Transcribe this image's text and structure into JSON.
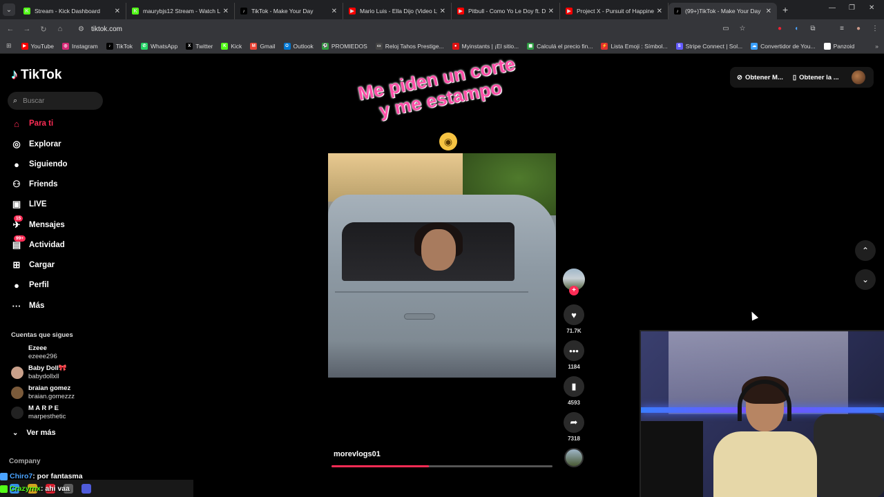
{
  "browser": {
    "tabs": [
      {
        "label": "Stream - Kick Dashboard",
        "fav_color": "#53fc18",
        "fav_text": "K",
        "active": false
      },
      {
        "label": "maurybjs12 Stream - Watch Live",
        "fav_color": "#53fc18",
        "fav_text": "K",
        "active": false
      },
      {
        "label": "TikTok - Make Your Day",
        "fav_color": "#000000",
        "fav_text": "♪",
        "active": false
      },
      {
        "label": "Mario Luis - Ella Dijo (Video Lyric)",
        "fav_color": "#ff0000",
        "fav_text": "▶",
        "active": false
      },
      {
        "label": "Pitbull - Como Yo Le Doy ft. Don",
        "fav_color": "#ff0000",
        "fav_text": "▶",
        "active": false
      },
      {
        "label": "Project X - Pursuit of Happiness",
        "fav_color": "#ff0000",
        "fav_text": "▶",
        "active": false
      },
      {
        "label": "(99+)TikTok - Make Your Day",
        "fav_color": "#000000",
        "fav_text": "♪",
        "active": true
      }
    ],
    "url": "tiktok.com",
    "bookmarks": [
      {
        "label": "YouTube",
        "color": "#ff0000",
        "glyph": "▶"
      },
      {
        "label": "Instagram",
        "color": "#d62976",
        "glyph": "◎"
      },
      {
        "label": "TikTok",
        "color": "#000000",
        "glyph": "♪"
      },
      {
        "label": "WhatsApp",
        "color": "#25d366",
        "glyph": "✆"
      },
      {
        "label": "Twitter",
        "color": "#000000",
        "glyph": "X"
      },
      {
        "label": "Kick",
        "color": "#53fc18",
        "glyph": "K"
      },
      {
        "label": "Gmail",
        "color": "#ea4335",
        "glyph": "M"
      },
      {
        "label": "Outlook",
        "color": "#0078d4",
        "glyph": "O"
      },
      {
        "label": "PROMIEDOS",
        "color": "#2e9e3e",
        "glyph": "⚽"
      },
      {
        "label": "Reloj Tahos Prestige...",
        "color": "#444444",
        "glyph": "▭"
      },
      {
        "label": "Myinstants | ¡El sitio...",
        "color": "#d11",
        "glyph": "●"
      },
      {
        "label": "Calculá el precio fin...",
        "color": "#2f9e44",
        "glyph": "▦"
      },
      {
        "label": "Lista Emoji : Símbol...",
        "color": "#e0302e",
        "glyph": "⚡"
      },
      {
        "label": "Stripe Connect | Sol...",
        "color": "#635bff",
        "glyph": "S"
      },
      {
        "label": "Convertidor de You...",
        "color": "#3aa0ff",
        "glyph": "☁"
      },
      {
        "label": "Panzoid",
        "color": "#ffffff",
        "glyph": "P"
      }
    ]
  },
  "tiktok": {
    "brand": "TikTok",
    "search_placeholder": "Buscar",
    "nav": [
      {
        "label": "Para ti",
        "icon": "home-icon",
        "glyph": "⌂",
        "active": true,
        "badge": ""
      },
      {
        "label": "Explorar",
        "icon": "compass-icon",
        "glyph": "◎",
        "active": false,
        "badge": ""
      },
      {
        "label": "Siguiendo",
        "icon": "following-avatar-icon",
        "glyph": "●",
        "active": false,
        "badge": ""
      },
      {
        "label": "Friends",
        "icon": "friends-icon",
        "glyph": "⚇",
        "active": false,
        "badge": ""
      },
      {
        "label": "LIVE",
        "icon": "live-icon",
        "glyph": "▣",
        "active": false,
        "badge": ""
      },
      {
        "label": "Mensajes",
        "icon": "messages-icon",
        "glyph": "✈",
        "active": false,
        "badge": "15"
      },
      {
        "label": "Actividad",
        "icon": "activity-icon",
        "glyph": "▤",
        "active": false,
        "badge": "99+"
      },
      {
        "label": "Cargar",
        "icon": "upload-icon",
        "glyph": "⊞",
        "active": false,
        "badge": ""
      },
      {
        "label": "Perfil",
        "icon": "profile-avatar-icon",
        "glyph": "●",
        "active": false,
        "badge": ""
      },
      {
        "label": "Más",
        "icon": "more-icon",
        "glyph": "···",
        "active": false,
        "badge": ""
      }
    ],
    "following_header": "Cuentas que sigues",
    "following": [
      {
        "name": "Ezeee",
        "handle": "ezeee296",
        "color": "#000000"
      },
      {
        "name": "Baby Doll🎀",
        "handle": "babydollxll",
        "color": "#c9a08a"
      },
      {
        "name": "braian gomez",
        "handle": "braian.gomezzz",
        "color": "#7a5a3a"
      },
      {
        "name": "M A R P E",
        "handle": "marpesthetic",
        "color": "#222222"
      }
    ],
    "see_more": "Ver más",
    "company": "Company",
    "top_buttons": [
      "Obtener M...",
      "Obtener la ..."
    ],
    "caption_line1": "Me piden un corte",
    "caption_line2": "y me estampo",
    "video_author": "morevlogs01",
    "progress": 0.44,
    "actions": [
      {
        "icon": "heart-icon",
        "glyph": "♥",
        "count": "71.7K"
      },
      {
        "icon": "comment-icon",
        "glyph": "•••",
        "count": "1184"
      },
      {
        "icon": "bookmark-icon",
        "glyph": "▮",
        "count": "4593"
      },
      {
        "icon": "share-icon",
        "glyph": "➦",
        "count": "7318"
      }
    ]
  },
  "chat": [
    {
      "user": "Chiro7",
      "message": ": por fantasma",
      "color": "#4aa3ff"
    },
    {
      "user": "Crazyrnx",
      "message": ": ahi vaa",
      "color": "#53fc18"
    }
  ]
}
